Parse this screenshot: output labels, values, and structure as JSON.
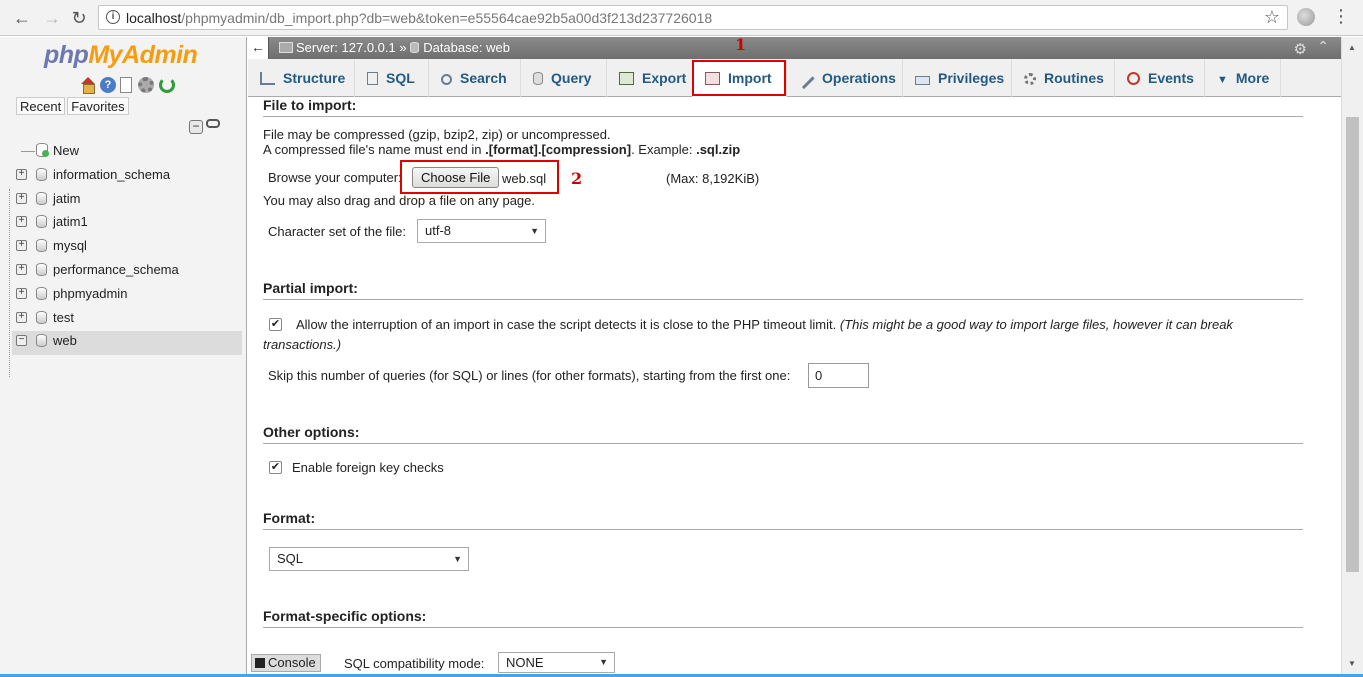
{
  "browser": {
    "url_host": "localhost",
    "url_path": "/phpmyadmin/db_import.php?db=web&token=e55564cae92b5a00d3f213d237726018"
  },
  "logo": {
    "php": "php",
    "myadmin": "MyAdmin"
  },
  "nav": {
    "recent_label": "Recent",
    "favorites_label": "Favorites",
    "new_label": "New",
    "databases": [
      "information_schema",
      "jatim",
      "jatim1",
      "mysql",
      "performance_schema",
      "phpmyadmin",
      "test",
      "web"
    ],
    "selected": "web"
  },
  "breadcrumb": {
    "server": "Server: 127.0.0.1 »",
    "database": "Database: web"
  },
  "tabs": [
    "Structure",
    "SQL",
    "Search",
    "Query",
    "Export",
    "Import",
    "Operations",
    "Privileges",
    "Routines",
    "Events",
    "More"
  ],
  "active_tab": "Import",
  "annotations": {
    "step1": "1",
    "step2": "2",
    "color": "#e00000"
  },
  "file_import": {
    "title": "File to import:",
    "line1": "File may be compressed (gzip, bzip2, zip) or uncompressed.",
    "line2_prefix": "A compressed file's name must end in ",
    "line2_format": ".[format].[compression]",
    "line2_mid": ". Example: ",
    "line2_example": ".sql.zip",
    "browse_label": "Browse your computer:",
    "choose_button": "Choose File",
    "chosen_file": "web.sql",
    "max_size": "(Max: 8,192KiB)",
    "drag_text": "You may also drag and drop a file on any page.",
    "charset_label": "Character set of the file:",
    "charset_value": "utf-8"
  },
  "partial_import": {
    "title": "Partial import:",
    "allow_interrupt": "Allow the interruption of an import in case the script detects it is close to the PHP timeout limit.",
    "allow_interrupt_note": "(This might be a good way to import large files, however it can break",
    "allow_interrupt_note2": "transactions.)",
    "allow_interrupt_checked": true,
    "skip_label": "Skip this number of queries (for SQL) or lines (for other formats), starting from the first one:",
    "skip_value": "0"
  },
  "other_options": {
    "title": "Other options:",
    "fk_label": "Enable foreign key checks",
    "fk_checked": true
  },
  "format": {
    "title": "Format:",
    "value": "SQL"
  },
  "format_specific": {
    "title": "Format-specific options:",
    "compat_label": "SQL compatibility mode:",
    "compat_value": "NONE"
  },
  "console": {
    "label": "Console"
  }
}
